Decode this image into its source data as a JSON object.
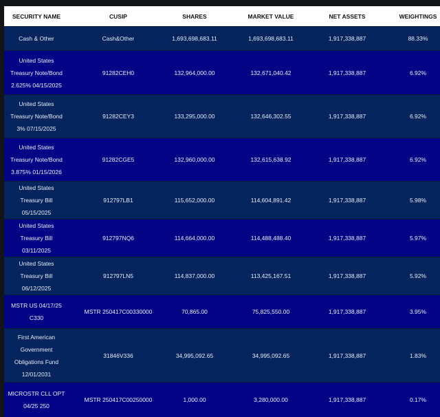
{
  "table": {
    "headers": [
      "SECURITY NAME",
      "CUSIP",
      "SHARES",
      "MARKET VALUE",
      "NET ASSETS",
      "WEIGHTINGS"
    ],
    "rows": [
      {
        "name": "Cash & Other",
        "cusip": "Cash&Other",
        "shares": "1,693,698,683.11",
        "market_value": "1,693,698,683.11",
        "net_assets": "1,917,338,887",
        "weighting": "88.33%"
      },
      {
        "name": "United States Treasury Note/Bond 2.625% 04/15/2025",
        "cusip": "91282CEH0",
        "shares": "132,964,000.00",
        "market_value": "132,671,040.42",
        "net_assets": "1,917,338,887",
        "weighting": "6.92%"
      },
      {
        "name": "United States Treasury Note/Bond 3% 07/15/2025",
        "cusip": "91282CEY3",
        "shares": "133,295,000.00",
        "market_value": "132,646,302.55",
        "net_assets": "1,917,338,887",
        "weighting": "6.92%"
      },
      {
        "name": "United States Treasury Note/Bond 3.875% 01/15/2026",
        "cusip": "91282CGE5",
        "shares": "132,960,000.00",
        "market_value": "132,615,638.92",
        "net_assets": "1,917,338,887",
        "weighting": "6.92%"
      },
      {
        "name": "United States Treasury Bill 05/15/2025",
        "cusip": "912797LB1",
        "shares": "115,652,000.00",
        "market_value": "114,604,891.42",
        "net_assets": "1,917,338,887",
        "weighting": "5.98%"
      },
      {
        "name": "United States Treasury Bill 03/11/2025",
        "cusip": "912797NQ6",
        "shares": "114,664,000.00",
        "market_value": "114,488,488.40",
        "net_assets": "1,917,338,887",
        "weighting": "5.97%"
      },
      {
        "name": "United States Treasury Bill 06/12/2025",
        "cusip": "912797LN5",
        "shares": "114,837,000.00",
        "market_value": "113,425,167.51",
        "net_assets": "1,917,338,887",
        "weighting": "5.92%"
      },
      {
        "name": "MSTR US 04/17/25 C330",
        "cusip": "MSTR 250417C00330000",
        "shares": "70,865.00",
        "market_value": "75,825,550.00",
        "net_assets": "1,917,338,887",
        "weighting": "3.95%"
      },
      {
        "name": "First American Government Obligations Fund 12/01/2031",
        "cusip": "31846V336",
        "shares": "34,995,092.65",
        "market_value": "34,995,092.65",
        "net_assets": "1,917,338,887",
        "weighting": "1.83%"
      },
      {
        "name": "MICROSTR CLL OPT 04/25 250",
        "cusip": "MSTR 250417C00250000",
        "shares": "1,000.00",
        "market_value": "3,280,000.00",
        "net_assets": "1,917,338,887",
        "weighting": "0.17%"
      }
    ]
  },
  "colors": {
    "header_bg": "#ffffff",
    "row_dark": "#04245e",
    "row_blue": "#020486",
    "page_bg": "#131418"
  }
}
